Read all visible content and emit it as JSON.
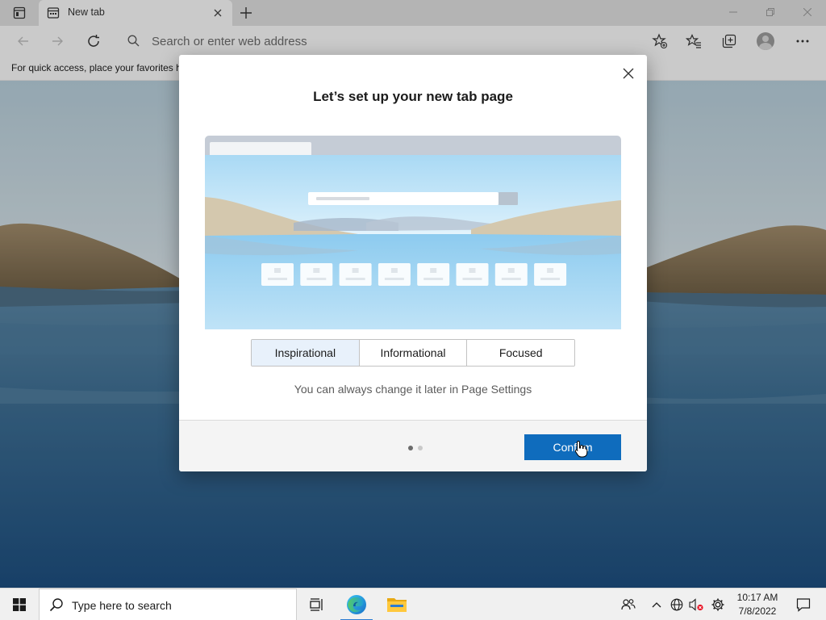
{
  "browser": {
    "tab_title": "New tab",
    "address_placeholder": "Search or enter web address",
    "favorites_bar_text": "For quick access, place your favorites h"
  },
  "modal": {
    "title": "Let’s set up your new tab page",
    "options": [
      {
        "label": "Inspirational",
        "selected": true
      },
      {
        "label": "Informational",
        "selected": false
      },
      {
        "label": "Focused",
        "selected": false
      }
    ],
    "hint": "You can always change it later in Page Settings",
    "confirm_label": "Confirm",
    "step": {
      "current": 1,
      "total": 2
    }
  },
  "taskbar": {
    "search_placeholder": "Type here to search",
    "apps": [
      "task-view-icon",
      "edge-icon",
      "file-explorer-icon"
    ],
    "tray_icons": [
      "people-icon",
      "chevron-up-icon",
      "network-icon",
      "volume-muted-icon",
      "settings-icon"
    ],
    "time": "10:17 AM",
    "date": "7/8/2022"
  },
  "colors": {
    "accent": "#0f6cbd",
    "selected_option_bg": "#e8f1fb",
    "taskbar_bg": "#f0f0f0",
    "chrome_bg": "#f7f7f7"
  }
}
